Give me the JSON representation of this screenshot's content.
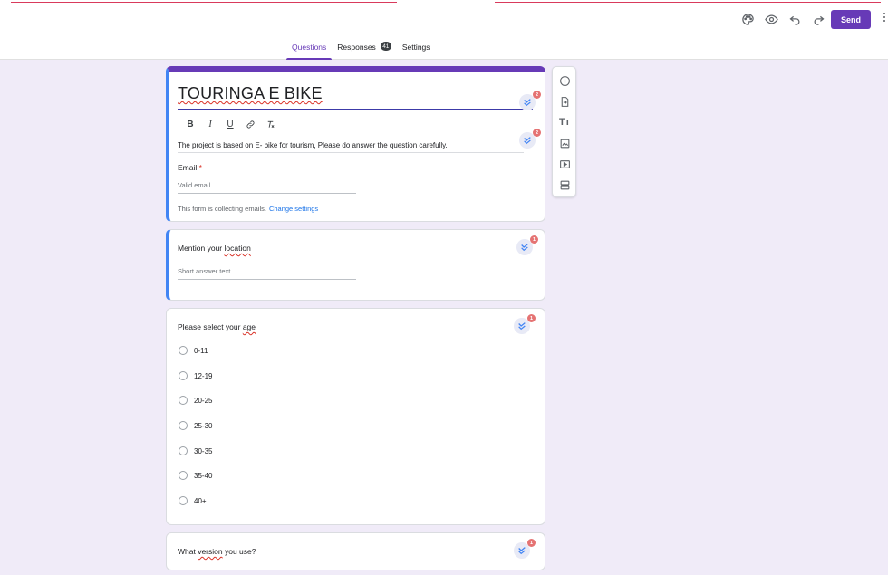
{
  "toolbar": {
    "icons": [
      "palette-icon",
      "preview-eye-icon",
      "undo-icon",
      "redo-icon"
    ],
    "send_label": "Send",
    "accent": "#673ab7"
  },
  "tabs": [
    {
      "label": "Questions",
      "active": true
    },
    {
      "label": "Responses",
      "badge": "41"
    },
    {
      "label": "Settings"
    }
  ],
  "form": {
    "title": "TOURINGA E BIKE",
    "title_badge": "2",
    "description": "The project is based on E- bike for tourism, Please do answer the question carefully.",
    "description_badge": "2",
    "format_tools": [
      "bold-icon",
      "italic-icon",
      "underline-icon",
      "link-icon",
      "clear-format-icon"
    ],
    "email_label": "Email",
    "email_required": "*",
    "email_placeholder": "Valid email",
    "collecting_text": "This form is collecting emails.",
    "change_settings_label": "Change settings"
  },
  "questions": [
    {
      "text": "Mention your location",
      "badge": "1",
      "placeholder": "Short answer text"
    },
    {
      "text": "Please select your age",
      "badge": "1",
      "options": [
        "0-11",
        "12-19",
        "20-25",
        "25-30",
        "30-35",
        "35-40",
        "40+"
      ]
    },
    {
      "text": "What version you use?",
      "badge": "1"
    }
  ],
  "side_toolbar": [
    "add-question-icon",
    "import-questions-icon",
    "add-title-icon",
    "add-image-icon",
    "add-video-icon",
    "add-section-icon"
  ]
}
